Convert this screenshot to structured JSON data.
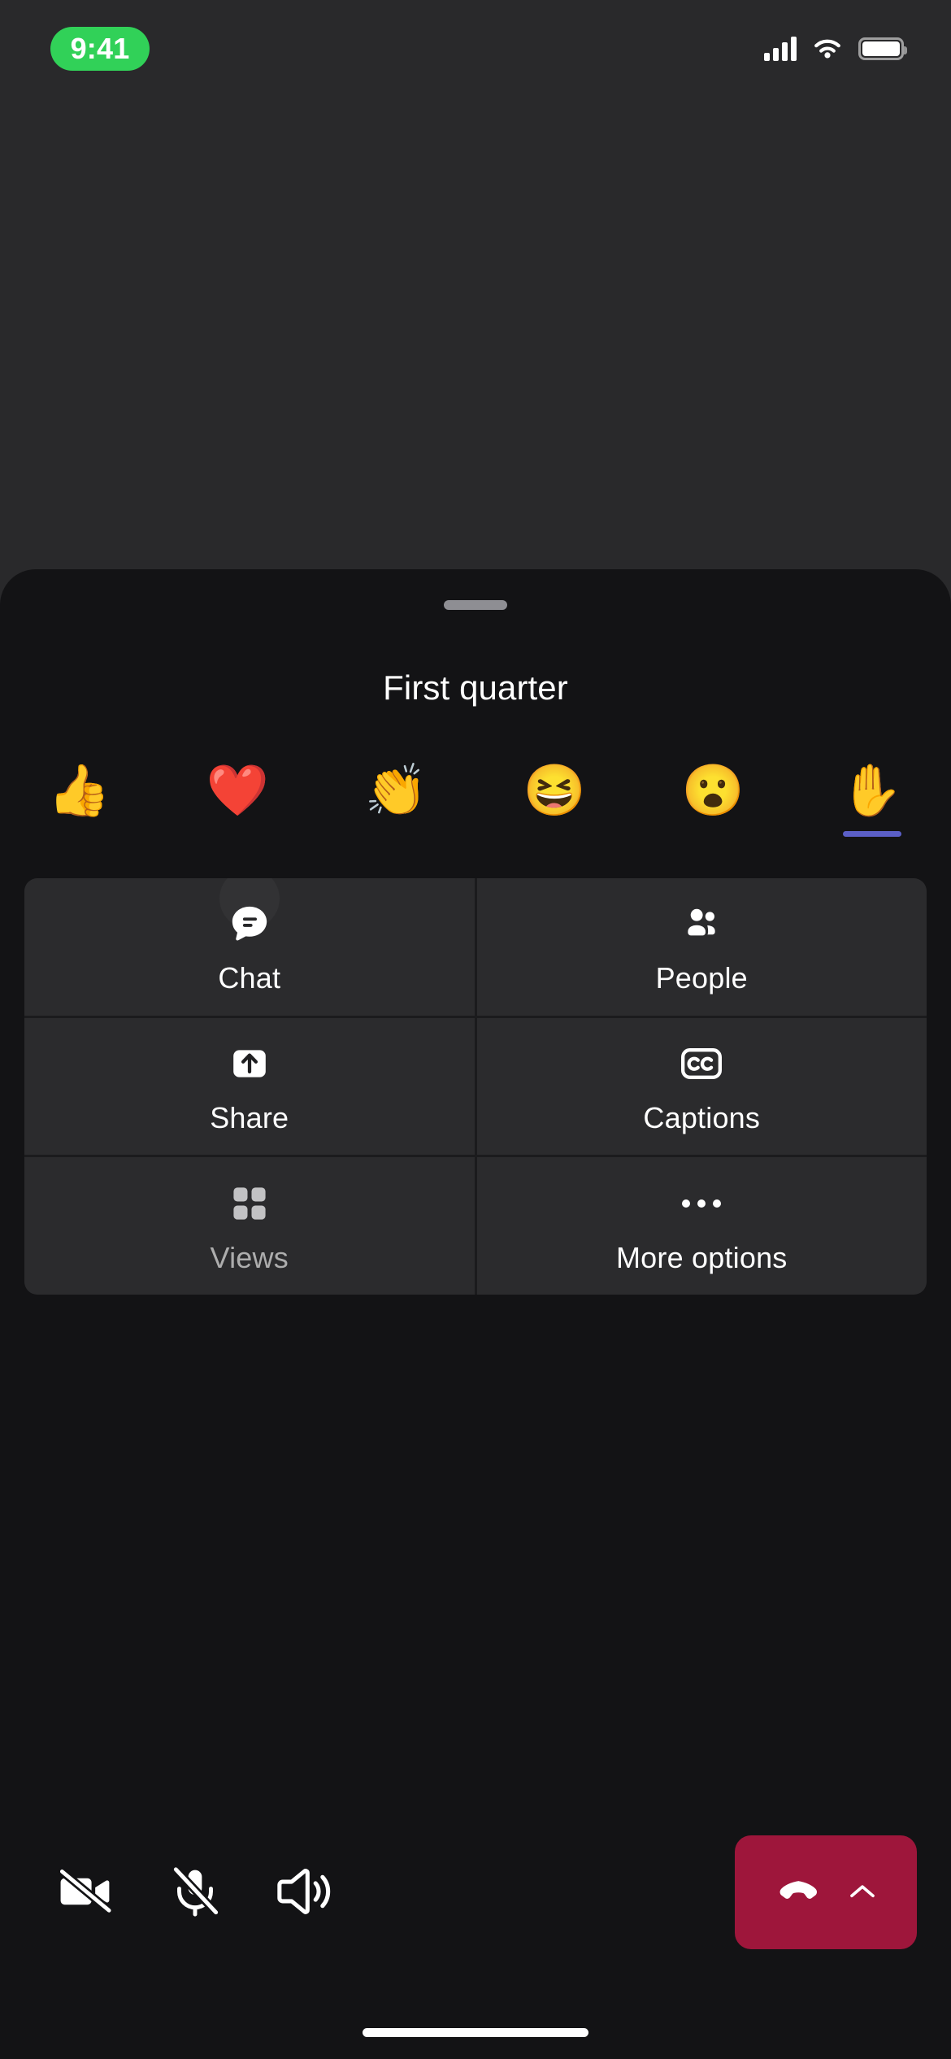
{
  "status_bar": {
    "time": "9:41",
    "time_pill_color": "#31d158",
    "signal_icon": "cellular-signal-icon",
    "wifi_icon": "wifi-icon",
    "battery_icon": "battery-icon"
  },
  "sheet": {
    "title": "First quarter",
    "handle": "drag-handle"
  },
  "reactions": {
    "accent_color": "#5b5fc7",
    "items": [
      {
        "name": "thumbs-up",
        "glyph": "👍",
        "label": "Like",
        "active": false
      },
      {
        "name": "heart",
        "glyph": "❤️",
        "label": "Heart",
        "active": false
      },
      {
        "name": "applause",
        "glyph": "👏",
        "label": "Applause",
        "active": false
      },
      {
        "name": "laugh",
        "glyph": "😆",
        "label": "Laugh",
        "active": false
      },
      {
        "name": "surprised",
        "glyph": "😮",
        "label": "Surprised",
        "active": false
      },
      {
        "name": "raise-hand",
        "glyph": "✋",
        "label": "Raise hand",
        "active": true
      }
    ]
  },
  "action_grid": {
    "cells": [
      {
        "key": "chat",
        "label": "Chat",
        "icon": "chat-bubble-icon",
        "disabled": false
      },
      {
        "key": "people",
        "label": "People",
        "icon": "people-icon",
        "disabled": false
      },
      {
        "key": "share",
        "label": "Share",
        "icon": "share-arrow-icon",
        "disabled": false
      },
      {
        "key": "captions",
        "label": "Captions",
        "icon": "closed-captions-icon",
        "disabled": false
      },
      {
        "key": "views",
        "label": "Views",
        "icon": "grid-views-icon",
        "disabled": true
      },
      {
        "key": "more-options",
        "label": "More options",
        "icon": "ellipsis-icon",
        "disabled": false
      }
    ]
  },
  "call_bar": {
    "camera": {
      "label": "Camera off",
      "icon": "video-off-icon",
      "state": "off"
    },
    "mic": {
      "label": "Mute",
      "icon": "mic-off-icon",
      "state": "off"
    },
    "audio": {
      "label": "Speaker",
      "icon": "speaker-icon",
      "state": "on"
    },
    "hangup": {
      "label": "Leave",
      "icon": "hang-up-icon",
      "chevron_icon": "chevron-up-icon",
      "color": "#9e163b"
    }
  },
  "home_indicator": "home-indicator"
}
